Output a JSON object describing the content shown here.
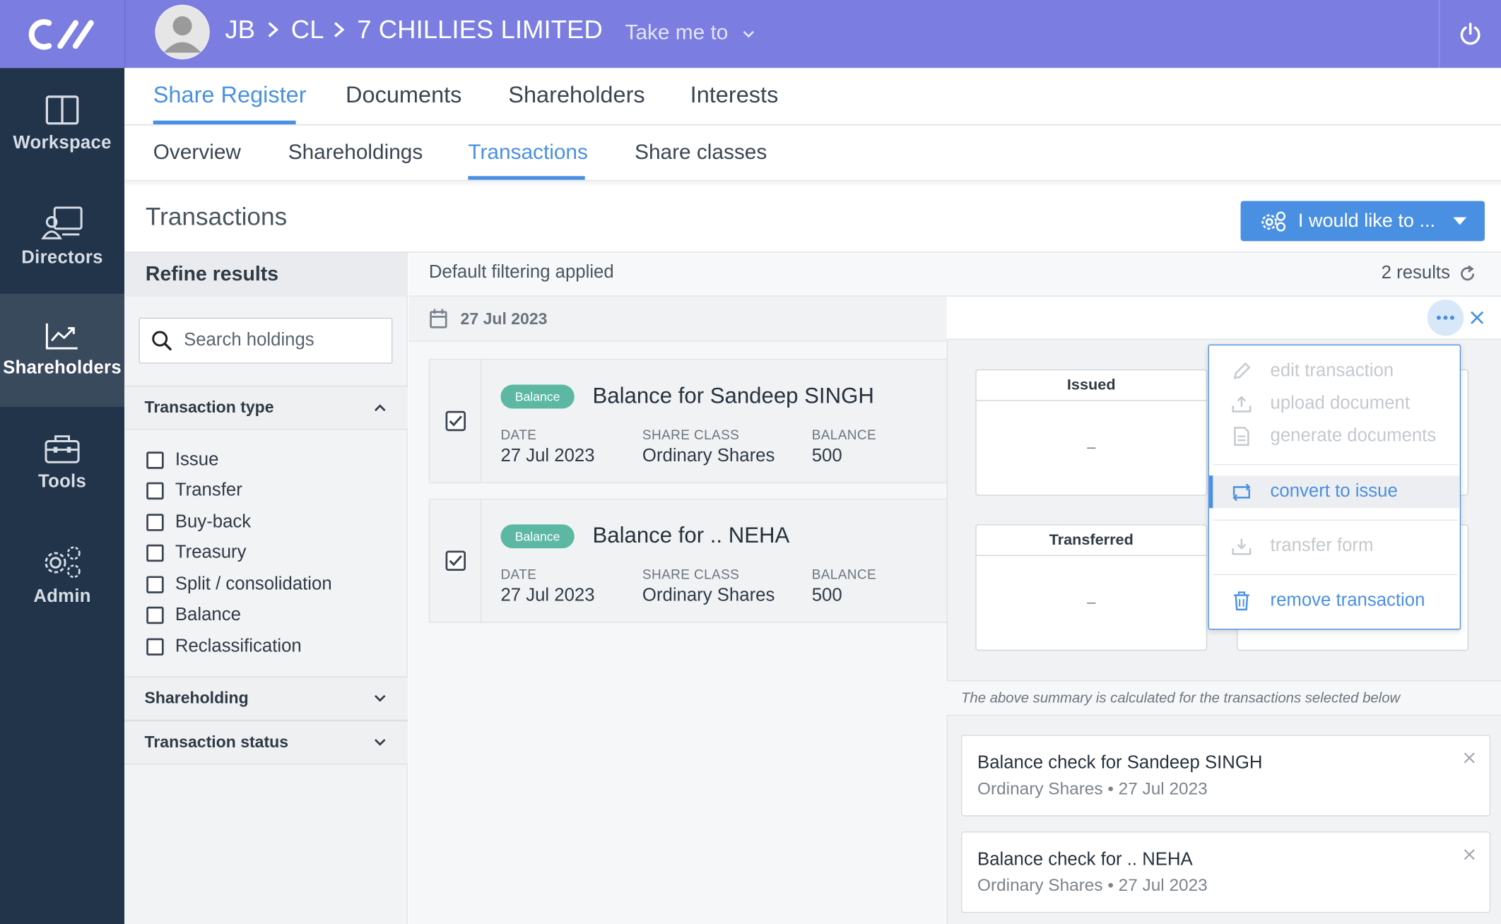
{
  "header": {
    "breadcrumb": [
      "JB",
      "CL",
      "7 CHILLIES LIMITED"
    ],
    "take_me_to": "Take me to"
  },
  "sidebar": {
    "items": [
      {
        "label": "Workspace",
        "icon": "workspace-icon"
      },
      {
        "label": "Directors",
        "icon": "directors-icon"
      },
      {
        "label": "Shareholders",
        "icon": "shareholders-chart-icon",
        "active": true
      },
      {
        "label": "Tools",
        "icon": "toolbox-icon"
      },
      {
        "label": "Admin",
        "icon": "gears-icon"
      }
    ]
  },
  "tabs": [
    "Share Register",
    "Documents",
    "Shareholders",
    "Interests"
  ],
  "subtabs": [
    "Overview",
    "Shareholdings",
    "Transactions",
    "Share classes"
  ],
  "page": {
    "title": "Transactions",
    "action_label": "I would like to ..."
  },
  "refine": {
    "title": "Refine results",
    "search_placeholder": "Search holdings",
    "transaction_type_label": "Transaction type",
    "types": [
      "Issue",
      "Transfer",
      "Buy-back",
      "Treasury",
      "Split / consolidation",
      "Balance",
      "Reclassification"
    ],
    "shareholding_label": "Shareholding",
    "status_label": "Transaction status"
  },
  "results": {
    "filter_text": "Default filtering applied",
    "count_text": "2 results",
    "date_group": "27 Jul 2023",
    "col_date": "DATE",
    "col_class": "SHARE CLASS",
    "col_balance": "BALANCE",
    "items": [
      {
        "badge": "Balance",
        "title": "Balance for Sandeep SINGH",
        "date": "27 Jul 2023",
        "share_class": "Ordinary Shares",
        "balance": "500",
        "checked": true
      },
      {
        "badge": "Balance",
        "title": "Balance for .. NEHA",
        "date": "27 Jul 2023",
        "share_class": "Ordinary Shares",
        "balance": "500",
        "checked": true
      }
    ]
  },
  "panel": {
    "summary": [
      {
        "label": "Issued",
        "value": "–"
      },
      {
        "label": "Transferred",
        "value": "–"
      }
    ],
    "note": "The above summary is calculated for the transactions selected below",
    "selected": [
      {
        "title": "Balance check for Sandeep SINGH",
        "sub": "Ordinary Shares • 27 Jul 2023"
      },
      {
        "title": "Balance check for .. NEHA",
        "sub": "Ordinary Shares • 27 Jul 2023"
      }
    ]
  },
  "menu": {
    "items": [
      {
        "label": "edit transaction",
        "enabled": false,
        "icon": "pencil-icon"
      },
      {
        "label": "upload document",
        "enabled": false,
        "icon": "upload-icon"
      },
      {
        "label": "generate documents",
        "enabled": false,
        "icon": "document-icon"
      },
      {
        "label": "convert to issue",
        "enabled": true,
        "icon": "convert-icon"
      },
      {
        "label": "transfer form",
        "enabled": false,
        "icon": "download-tray-icon"
      },
      {
        "label": "remove transaction",
        "enabled": true,
        "icon": "trash-icon"
      }
    ]
  },
  "colors": {
    "header": "#7b7ee0",
    "sidebar": "#22344a",
    "accent": "#4a90e2",
    "badge": "#5cb8a2"
  }
}
